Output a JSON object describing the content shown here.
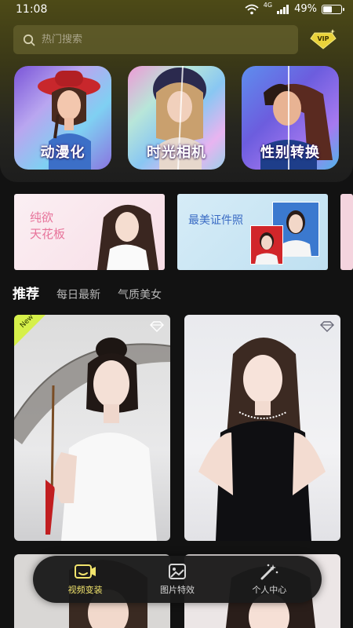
{
  "status_bar": {
    "time": "11:08",
    "network": "4G",
    "battery": "49%"
  },
  "search": {
    "placeholder": "热门搜索"
  },
  "vip_badge": {
    "label": "VIP"
  },
  "feature_cards": [
    {
      "label": "动漫化"
    },
    {
      "label": "时光相机"
    },
    {
      "label": "性别转换"
    }
  ],
  "banners": [
    {
      "line1": "纯欲",
      "line2": "天花板"
    },
    {
      "text": "最美证件照"
    }
  ],
  "tabs": [
    {
      "label": "推荐",
      "active": true
    },
    {
      "label": "每日最新",
      "active": false
    },
    {
      "label": "气质美女",
      "active": false
    }
  ],
  "grid": {
    "new_badge": "New"
  },
  "bottom_nav": [
    {
      "label": "视频变装",
      "icon": "video-icon",
      "active": true
    },
    {
      "label": "图片特效",
      "icon": "image-icon",
      "active": false
    },
    {
      "label": "个人中心",
      "icon": "magic-wand-icon",
      "active": false
    }
  ],
  "colors": {
    "accent": "#f2e46d",
    "background": "#121212",
    "top_gradient": "#4d4a17"
  }
}
